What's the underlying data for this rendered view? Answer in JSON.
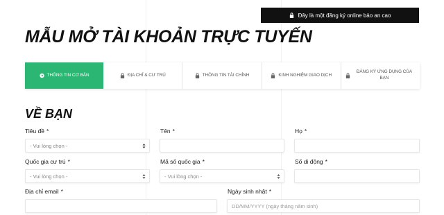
{
  "banner": {
    "text": "Đây là một đăng ký online bảo an cao",
    "icon": "lock-icon"
  },
  "page_title": "MẪU MỞ TÀI KHOẢN TRỰC TUYẾN",
  "steps": [
    {
      "label": "THÔNG TIN CƠ BẢN",
      "icon": "circle-arrow-icon",
      "active": true
    },
    {
      "label": "ĐỊA CHỈ & CƯ TRÚ",
      "icon": "lock-icon",
      "active": false
    },
    {
      "label": "THÔNG TIN TÀI CHÍNH",
      "icon": "lock-icon",
      "active": false
    },
    {
      "label": "KINH NGHIỆM GIAO DỊCH",
      "icon": "lock-icon",
      "active": false
    },
    {
      "label": "ĐĂNG KÝ ỨNG DỤNG CỦA BẠN",
      "icon": "lock-icon",
      "active": false
    }
  ],
  "section_title": "VỀ BẠN",
  "fields": {
    "title": {
      "label": "Tiêu đề",
      "required": "*",
      "value": "- Vui lòng chọn -"
    },
    "first_name": {
      "label": "Tên",
      "required": "*",
      "value": ""
    },
    "last_name": {
      "label": "Họ",
      "required": "*",
      "value": ""
    },
    "country": {
      "label": "Quốc gia cư trú",
      "required": "*",
      "value": "- Vui lòng chọn -"
    },
    "country_code": {
      "label": "Mã số quốc gia",
      "required": "*",
      "value": "- Vui lòng chọn -"
    },
    "mobile": {
      "label": "Số di động",
      "required": "*",
      "value": ""
    },
    "email": {
      "label": "Địa chỉ email",
      "required": "*",
      "value": ""
    },
    "birthday": {
      "label": "Ngày sinh nhật",
      "required": "*",
      "placeholder": "DD/MM/YYYY (ngày tháng năm sinh)"
    }
  },
  "colors": {
    "accent": "#2bb673",
    "banner_bg": "#111111"
  }
}
